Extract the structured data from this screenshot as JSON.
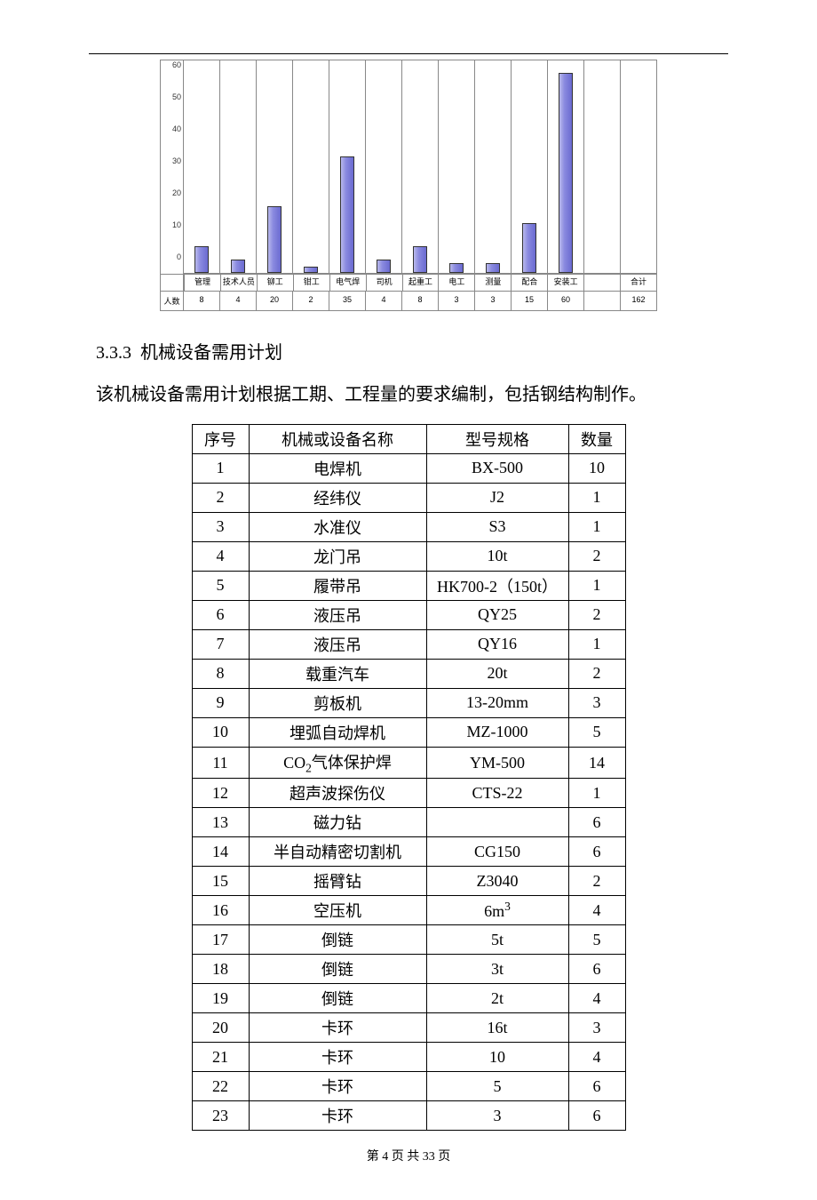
{
  "chart_data": {
    "type": "bar",
    "ylim": [
      0,
      60
    ],
    "yticks": [
      0,
      10,
      20,
      30,
      40,
      50,
      60
    ],
    "row_label": "人数",
    "series": [
      {
        "label": "管理",
        "value": 8
      },
      {
        "label": "技术人员",
        "value": 4
      },
      {
        "label": "铆工",
        "value": 20
      },
      {
        "label": "钳工",
        "value": 2
      },
      {
        "label": "电气焊",
        "value": 35
      },
      {
        "label": "司机",
        "value": 4
      },
      {
        "label": "起重工",
        "value": 8
      },
      {
        "label": "电工",
        "value": 3
      },
      {
        "label": "测量",
        "value": 3
      },
      {
        "label": "配合",
        "value": 15
      },
      {
        "label": "安装工",
        "value": 60
      },
      {
        "label": "",
        "value": null
      },
      {
        "label": "合计",
        "value": 162
      }
    ]
  },
  "section": {
    "number": "3.3.3",
    "title": "机械设备需用计划",
    "paragraph": "该机械设备需用计划根据工期、工程量的要求编制，包括钢结构制作。"
  },
  "table": {
    "headers": {
      "no": "序号",
      "name": "机械或设备名称",
      "spec": "型号规格",
      "qty": "数量"
    },
    "rows": [
      {
        "no": "1",
        "name": "电焊机",
        "spec": "BX-500",
        "qty": "10"
      },
      {
        "no": "2",
        "name": "经纬仪",
        "spec": "J2",
        "qty": "1"
      },
      {
        "no": "3",
        "name": "水准仪",
        "spec": "S3",
        "qty": "1"
      },
      {
        "no": "4",
        "name": "龙门吊",
        "spec": "10t",
        "qty": "2"
      },
      {
        "no": "5",
        "name": "履带吊",
        "spec": "HK700-2（150t）",
        "qty": "1"
      },
      {
        "no": "6",
        "name": "液压吊",
        "spec": "QY25",
        "qty": "2"
      },
      {
        "no": "7",
        "name": "液压吊",
        "spec": "QY16",
        "qty": "1"
      },
      {
        "no": "8",
        "name": "载重汽车",
        "spec": "20t",
        "qty": "2"
      },
      {
        "no": "9",
        "name": "剪板机",
        "spec": "13-20mm",
        "qty": "3"
      },
      {
        "no": "10",
        "name": "埋弧自动焊机",
        "spec": "MZ-1000",
        "qty": "5"
      },
      {
        "no": "11",
        "name": "CO₂气体保护焊",
        "spec": "YM-500",
        "qty": "14"
      },
      {
        "no": "12",
        "name": "超声波探伤仪",
        "spec": "CTS-22",
        "qty": "1"
      },
      {
        "no": "13",
        "name": "磁力钻",
        "spec": "",
        "qty": "6"
      },
      {
        "no": "14",
        "name": "半自动精密切割机",
        "spec": "CG150",
        "qty": "6"
      },
      {
        "no": "15",
        "name": "摇臂钻",
        "spec": "Z3040",
        "qty": "2"
      },
      {
        "no": "16",
        "name": "空压机",
        "spec": "6m³",
        "qty": "4"
      },
      {
        "no": "17",
        "name": "倒链",
        "spec": "5t",
        "qty": "5"
      },
      {
        "no": "18",
        "name": "倒链",
        "spec": "3t",
        "qty": "6"
      },
      {
        "no": "19",
        "name": "倒链",
        "spec": "2t",
        "qty": "4"
      },
      {
        "no": "20",
        "name": "卡环",
        "spec": "16t",
        "qty": "3"
      },
      {
        "no": "21",
        "name": "卡环",
        "spec": "10",
        "qty": "4"
      },
      {
        "no": "22",
        "name": "卡环",
        "spec": "5",
        "qty": "6"
      },
      {
        "no": "23",
        "name": "卡环",
        "spec": "3",
        "qty": "6"
      }
    ]
  },
  "footer": {
    "text": "第 4 页 共 33 页"
  }
}
